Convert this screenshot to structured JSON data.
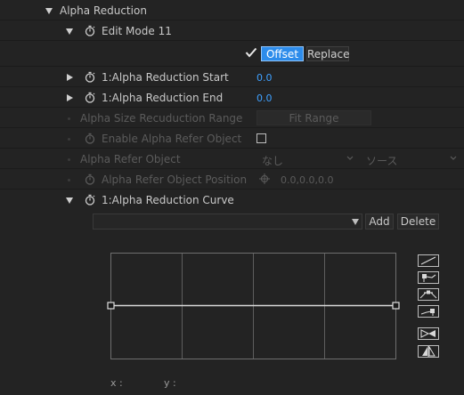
{
  "panel": {
    "section_title": "Alpha Reduction",
    "edit_mode_label": "Edit Mode 11",
    "mode_buttons": {
      "offset": "Offset",
      "replace": "Replace"
    },
    "params": {
      "start_label": "1:Alpha Reduction Start",
      "start_value": "0.0",
      "end_label": "1:Alpha Reduction End",
      "end_value": "0.0",
      "size_range_label": "Alpha Size Recuduction Range",
      "fit_range_button": "Fit Range",
      "enable_refer_label": "Enable Alpha Refer Object",
      "refer_object_label": "Alpha Refer Object",
      "refer_object_value": "なし",
      "refer_source_value": "ソース",
      "refer_position_label": "Alpha Refer Object Position",
      "refer_position_value": "0.0,0.0,0.0"
    },
    "curve": {
      "label": "1:Alpha Reduction Curve",
      "dropdown_value": "",
      "add_button": "Add",
      "delete_button": "Delete",
      "x_label": "x :",
      "y_label": "y :",
      "tools": [
        "linear-curve-icon",
        "ease-in-icon",
        "bezier-curve-icon",
        "ease-out-icon",
        "flip-horizontal-icon",
        "mirror-icon"
      ]
    }
  }
}
